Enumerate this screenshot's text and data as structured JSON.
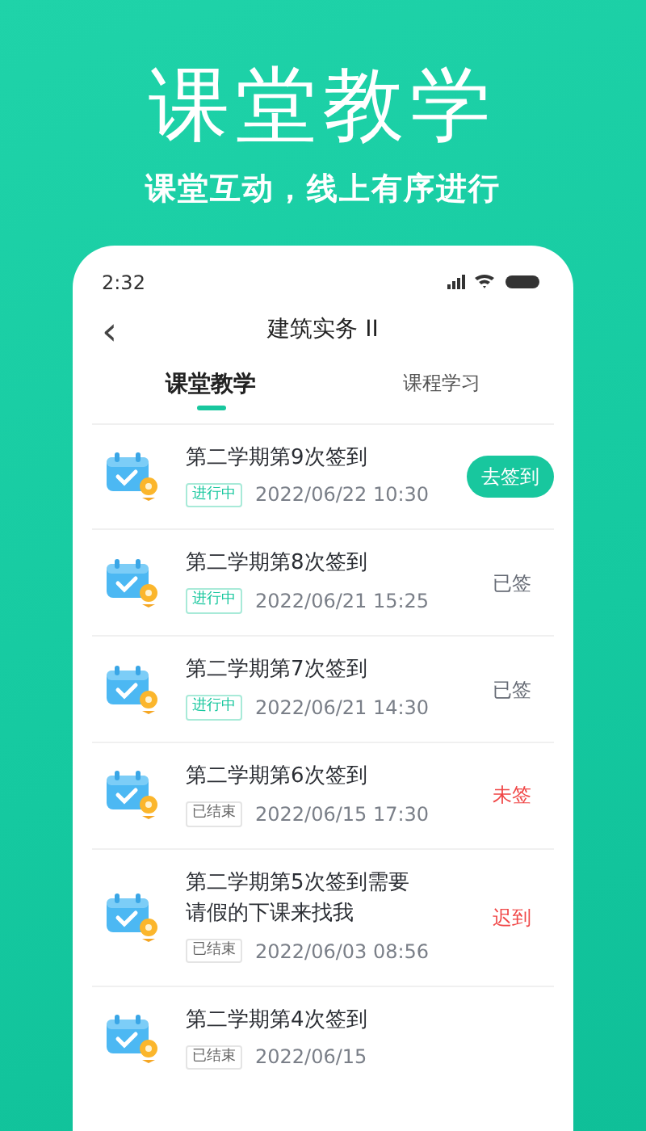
{
  "headline": "课堂教学",
  "subtitle": "课堂互动，线上有序进行",
  "status_bar": {
    "time": "2:32"
  },
  "nav": {
    "back": "‹",
    "title": "建筑实务 II"
  },
  "tabs": [
    {
      "label": "课堂教学",
      "selected": true
    },
    {
      "label": "课程学习",
      "selected": false
    }
  ],
  "checkins": [
    {
      "title": "第二学期第9次签到",
      "tag": {
        "label": "进行中",
        "kind": "ongoing"
      },
      "time": "2022/06/22 10:30",
      "action": {
        "kind": "button",
        "label": "去签到"
      }
    },
    {
      "title": "第二学期第8次签到",
      "tag": {
        "label": "进行中",
        "kind": "ongoing"
      },
      "time": "2022/06/21 15:25",
      "action": {
        "kind": "text",
        "label": "已签",
        "color": "#666b75"
      }
    },
    {
      "title": "第二学期第7次签到",
      "tag": {
        "label": "进行中",
        "kind": "ongoing"
      },
      "time": "2022/06/21 14:30",
      "action": {
        "kind": "text",
        "label": "已签",
        "color": "#666b75"
      }
    },
    {
      "title": "第二学期第6次签到",
      "tag": {
        "label": "已结束",
        "kind": "ended"
      },
      "time": "2022/06/15 17:30",
      "action": {
        "kind": "text",
        "label": "未签",
        "color": "#f04646"
      }
    },
    {
      "title": "第二学期第5次签到需要请假的下课来找我",
      "tag": {
        "label": "已结束",
        "kind": "ended"
      },
      "time": "2022/06/03 08:56",
      "action": {
        "kind": "text",
        "label": "迟到",
        "color": "#f04646"
      }
    },
    {
      "title": "第二学期第4次签到",
      "tag": {
        "label": "已结束",
        "kind": "ended"
      },
      "time": "2022/06/15"
    }
  ]
}
